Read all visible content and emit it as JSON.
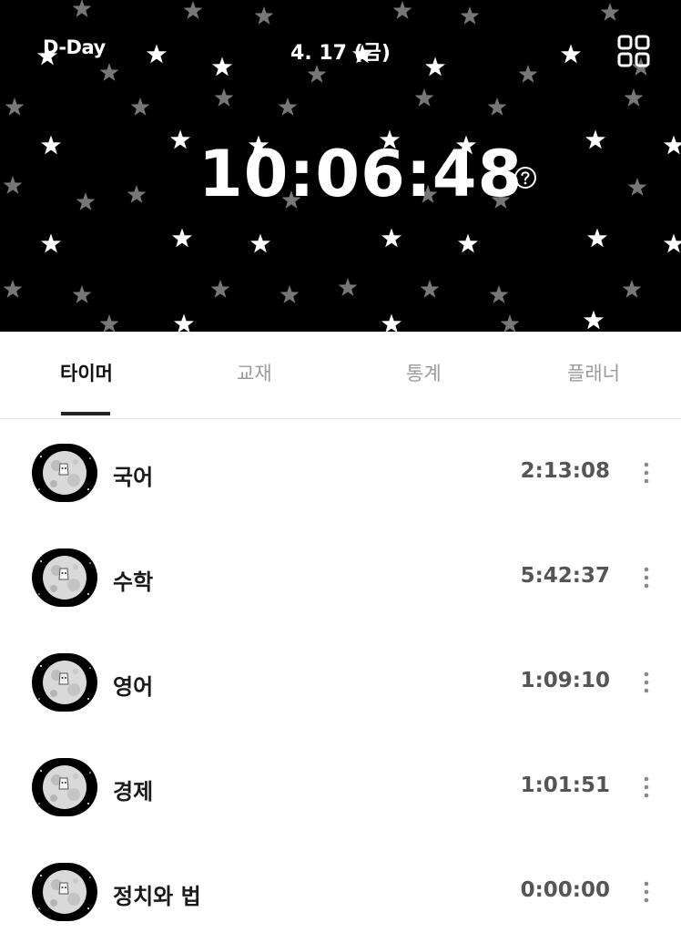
{
  "header": {
    "dday_label": "D-Day",
    "date": "4. 17 (금)",
    "clock": "10:06:48",
    "background_color": "#000000",
    "grid_icon": "grid-icon",
    "help_icon": "help-circle-icon"
  },
  "tabs": [
    {
      "label": "타이머",
      "active": true
    },
    {
      "label": "교재",
      "active": false
    },
    {
      "label": "통계",
      "active": false
    },
    {
      "label": "플래너",
      "active": false
    }
  ],
  "subjects": [
    {
      "name": "국어",
      "time": "2:13:08"
    },
    {
      "name": "수학",
      "time": "5:42:37"
    },
    {
      "name": "영어",
      "time": "1:09:10"
    },
    {
      "name": "경제",
      "time": "1:01:51"
    },
    {
      "name": "정치와 법",
      "time": "0:00:00"
    }
  ],
  "row_icon": "moon-avatar-icon",
  "more_icon": "more-vertical-icon"
}
